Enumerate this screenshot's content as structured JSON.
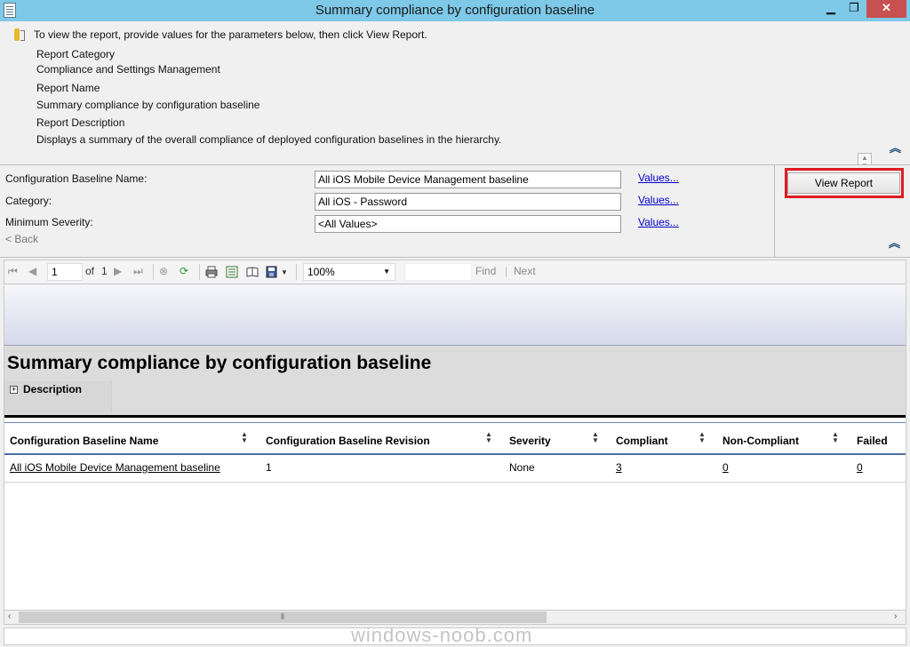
{
  "window": {
    "title": "Summary compliance by configuration baseline",
    "min_glyph": "▁",
    "max_glyph": "❐",
    "close_glyph": "✕"
  },
  "info": {
    "instructions": "To view the report, provide values for the parameters below, then click View Report.",
    "category_label": "Report Category",
    "category_value": "Compliance and Settings Management",
    "name_label": "Report Name",
    "name_value": "Summary compliance by configuration baseline",
    "description_label": "Report Description",
    "description_value": "Displays a summary of the overall compliance of deployed configuration baselines in the hierarchy."
  },
  "params": {
    "baseline_label": "Configuration Baseline Name:",
    "baseline_value": "All iOS Mobile Device Management baseline",
    "category_label": "Category:",
    "category_value": "All iOS - Password",
    "severity_label": "Minimum Severity:",
    "severity_value": "<All Values>",
    "values_link": "Values...",
    "back_label": "< Back",
    "view_report_label": "View Report"
  },
  "toolbar": {
    "page_number": "1",
    "of_label": "of",
    "total_pages": "1",
    "zoom": "100%",
    "find_label": "Find",
    "separator": "|",
    "next_label": "Next"
  },
  "report": {
    "title": "Summary compliance by configuration baseline",
    "description_toggle": "Description",
    "columns": [
      "Configuration Baseline Name",
      "Configuration Baseline Revision",
      "Severity",
      "Compliant",
      "Non-Compliant",
      "Failed"
    ],
    "rows": [
      {
        "name": "All iOS Mobile Device Management baseline",
        "revision": "1",
        "severity": "None",
        "compliant": "3",
        "non_compliant": "0",
        "failed": "0"
      }
    ]
  },
  "watermark": "windows-noob.com",
  "colors": {
    "titlebar": "#7ec8e8",
    "highlight_frame": "#e01a22",
    "link": "#0000cc"
  }
}
